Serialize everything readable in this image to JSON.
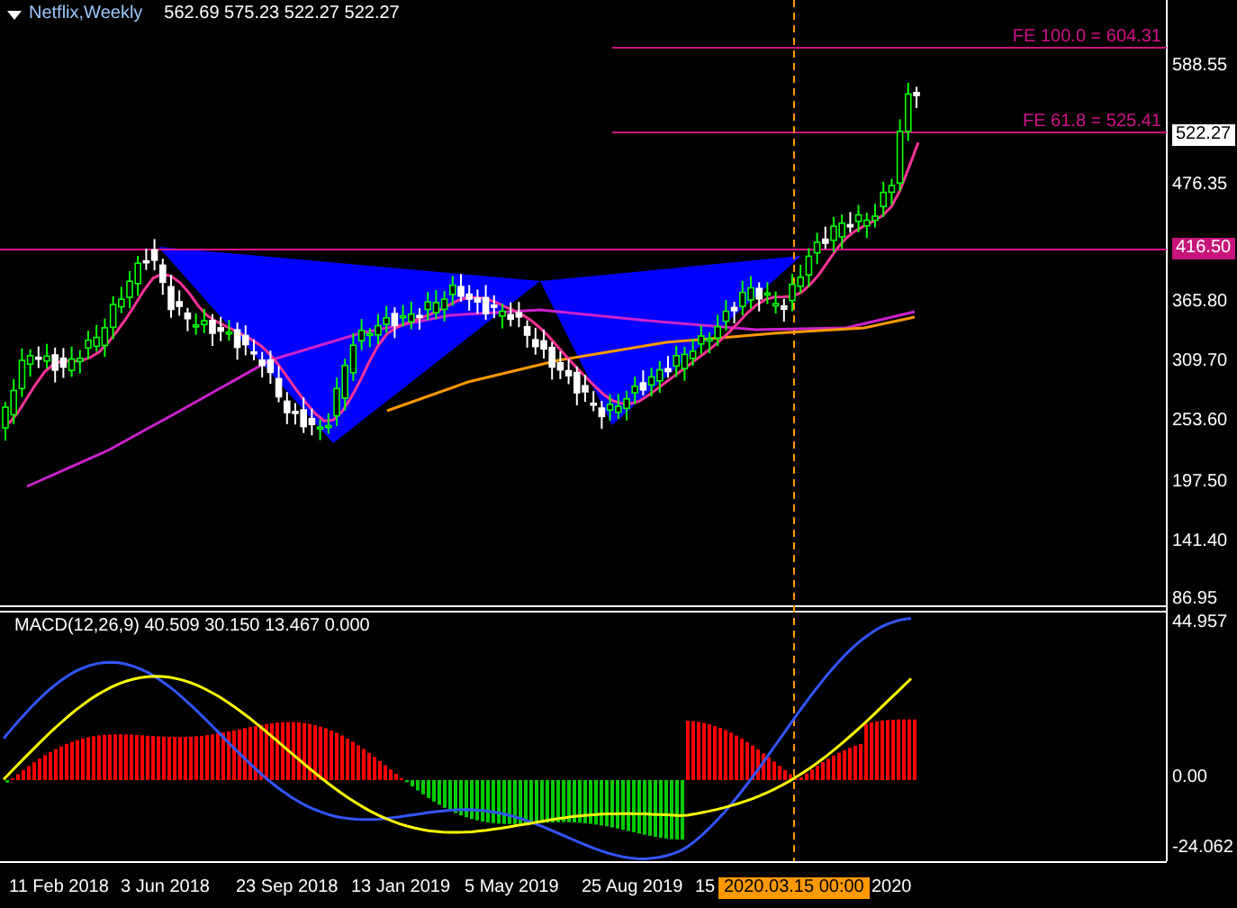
{
  "header": {
    "symbol": "Netflix,Weekly",
    "ohlc": "562.69 575.23 522.27 522.27"
  },
  "price_axis": [
    {
      "text": "588.55",
      "kind": "tick"
    },
    {
      "text": "522.27",
      "kind": "current"
    },
    {
      "text": "476.35",
      "kind": "tick"
    },
    {
      "text": "416.50",
      "kind": "level"
    },
    {
      "text": "365.80",
      "kind": "tick"
    },
    {
      "text": "309.70",
      "kind": "tick"
    },
    {
      "text": "253.60",
      "kind": "tick"
    },
    {
      "text": "197.50",
      "kind": "tick"
    },
    {
      "text": "141.40",
      "kind": "tick"
    },
    {
      "text": "86.95",
      "kind": "tick"
    }
  ],
  "fibo_labels": [
    "FE 100.0 = 604.31",
    "FE 61.8 = 525.41"
  ],
  "macd": {
    "label": "MACD(12,26,9) 40.509 30.150 13.467 0.000",
    "axis": [
      "44.957",
      "0.00",
      "-24.062"
    ]
  },
  "time_axis": [
    {
      "text": "11 Feb 2018",
      "kind": "date"
    },
    {
      "text": "3 Jun 2018",
      "kind": "date"
    },
    {
      "text": "23 Sep 2018",
      "kind": "date"
    },
    {
      "text": "13 Jan 2019",
      "kind": "date"
    },
    {
      "text": "5 May 2019",
      "kind": "date"
    },
    {
      "text": "25 Aug 2019",
      "kind": "date"
    },
    {
      "text": "15",
      "kind": "date"
    },
    {
      "text": "2020.03.15 00:00",
      "kind": "cursor"
    },
    {
      "text": "2020",
      "kind": "date"
    }
  ]
}
